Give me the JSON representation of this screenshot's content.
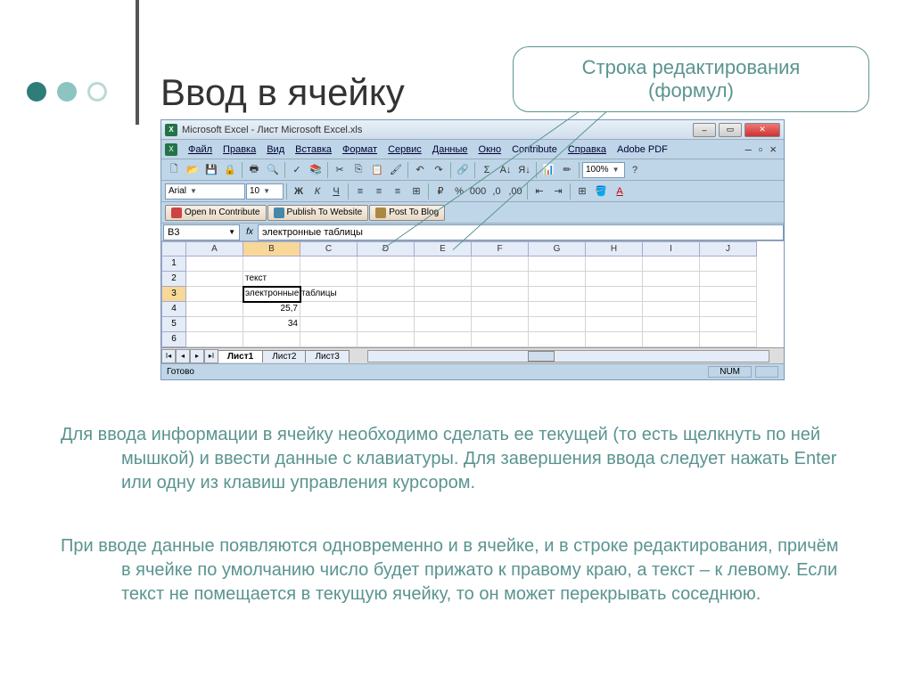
{
  "title": "Ввод в ячейку",
  "callout": {
    "line1": "Строка редактирования",
    "line2": "(формул)"
  },
  "window": {
    "title": "Microsoft Excel - Лист Microsoft Excel.xls",
    "menus": [
      "Файл",
      "Правка",
      "Вид",
      "Вставка",
      "Формат",
      "Сервис",
      "Данные",
      "Окно",
      "Contribute",
      "Справка",
      "Adobe PDF"
    ],
    "font": "Arial",
    "fontsize": "10",
    "zoom": "100%",
    "contribute": {
      "open": "Open In Contribute",
      "publish": "Publish To Website",
      "post": "Post To Blog"
    },
    "namebox": "B3",
    "fx": "fx",
    "formula": "электронные таблицы",
    "columns": [
      "A",
      "B",
      "C",
      "D",
      "E",
      "F",
      "G",
      "H",
      "I",
      "J"
    ],
    "rows": [
      "1",
      "2",
      "3",
      "4",
      "5",
      "6"
    ],
    "cells": {
      "B2": "текст",
      "B3": "электронные таблицы",
      "B4": "25,7",
      "B5": "34"
    },
    "sheets": [
      "Лист1",
      "Лист2",
      "Лист3"
    ],
    "status": "Готово",
    "numind": "NUM"
  },
  "para1": "Для ввода информации в ячейку необходимо сделать ее текущей (то есть щелкнуть по ней мышкой)  и ввести данные с клавиатуры. Для завершения ввода следует нажать Enter или одну из клавиш управления курсором.",
  "para2": "При вводе данные появляются одновременно и в ячейке, и в строке редактирования, причём в ячейке по умолчанию число будет прижато к правому краю, а текст – к левому. Если текст не помещается в текущую ячейку, то он может перекрывать соседнюю."
}
